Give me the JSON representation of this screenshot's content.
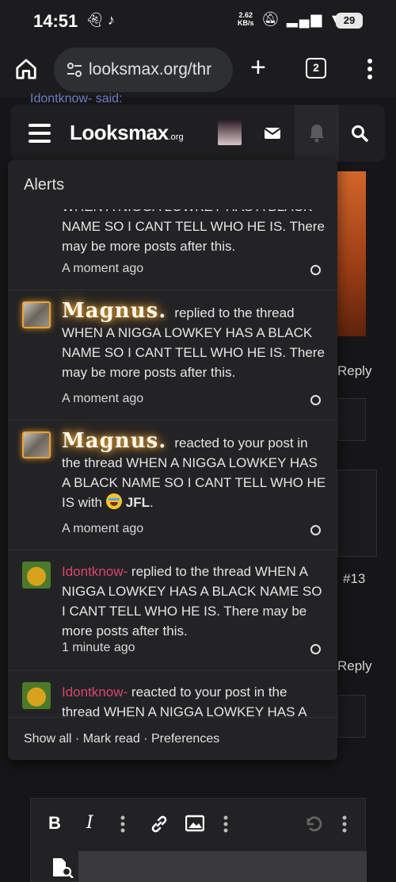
{
  "statusbar": {
    "time": "14:51",
    "speed_value": "2.62",
    "speed_unit": "KB/s",
    "battery": "29"
  },
  "browser": {
    "url": "looksmax.org/thr",
    "tab_count": "2"
  },
  "background": {
    "quote_text": "Idontknow- said:",
    "reply_1": "Reply",
    "post_number": "#13",
    "reply_2": "Reply"
  },
  "site": {
    "logo_main": "Looksmax",
    "logo_suffix": ".org"
  },
  "alerts": {
    "title": "Alerts",
    "items": [
      {
        "user": "",
        "action": "",
        "text": "WHEN A NIGGA LOWKEY HAS A BLACK NAME SO I CANT TELL WHO HE IS. There may be more posts after this.",
        "time": "A moment ago"
      },
      {
        "user": "Magnus.",
        "action": "replied to the thread",
        "text": "WHEN A NIGGA LOWKEY HAS A BLACK NAME SO I CANT TELL WHO HE IS. There may be more posts after this.",
        "time": "A moment ago"
      },
      {
        "user": "Magnus.",
        "action": "reacted to your post in the thread",
        "text": "WHEN A NIGGA LOWKEY HAS A BLACK NAME SO I CANT TELL WHO HE IS with",
        "reaction": "JFL",
        "reaction_suffix": ".",
        "time": "A moment ago"
      },
      {
        "user": "Idontknow-",
        "action": "replied to the thread",
        "text": "WHEN A NIGGA LOWKEY HAS A BLACK NAME SO I CANT TELL WHO HE IS. There may be more posts after this.",
        "time": "1 minute ago"
      },
      {
        "user": "Idontknow-",
        "action": "reacted to your post in the thread",
        "text": "WHEN A NIGGA LOWKEY HAS A",
        "time": ""
      }
    ],
    "footer": {
      "show_all": "Show all",
      "mark_read": "Mark read",
      "preferences": "Preferences",
      "separator": " · "
    }
  },
  "editor": {
    "tools": [
      "bold-icon",
      "italic-icon",
      "more-icon",
      "link-icon",
      "image-icon",
      "more-icon",
      "undo-icon",
      "more-icon"
    ]
  },
  "colors": {
    "accent_user": "#d8466b",
    "glow": "#f0b040",
    "background": "#161618",
    "panel": "#232325"
  }
}
